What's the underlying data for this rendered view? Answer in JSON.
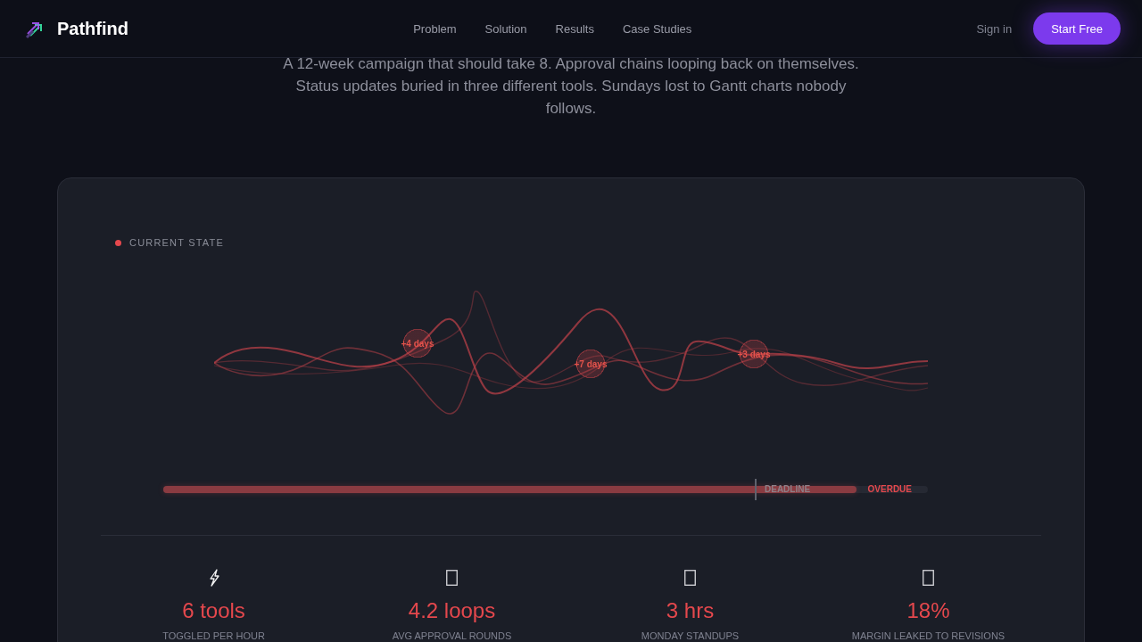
{
  "nav": {
    "brand": "Pathfind",
    "links": [
      "Problem",
      "Solution",
      "Results",
      "Case Studies"
    ],
    "sign_in": "Sign in",
    "cta": "Start Free"
  },
  "intro": "A 12-week campaign that should take 8. Approval chains looping back on themselves. Status updates buried in three different tools. Sundays lost to Gantt charts nobody follows.",
  "panel": {
    "status_label": "CURRENT STATE",
    "delays": [
      {
        "label": "+4 days"
      },
      {
        "label": "+7 days"
      },
      {
        "label": "+3 days"
      }
    ],
    "timeline": {
      "level": 0.907,
      "deadline_label": "DEADLINE",
      "overdue_label": "OVERDUE"
    },
    "stats": [
      {
        "value": "6 tools",
        "label": "TOGGLED PER HOUR"
      },
      {
        "value": "4.2 loops",
        "label": "AVG APPROVAL ROUNDS"
      },
      {
        "value": "3 hrs",
        "label": "MONDAY STANDUPS"
      },
      {
        "value": "18%",
        "label": "MARGIN LEAKED TO REVISIONS"
      }
    ]
  }
}
